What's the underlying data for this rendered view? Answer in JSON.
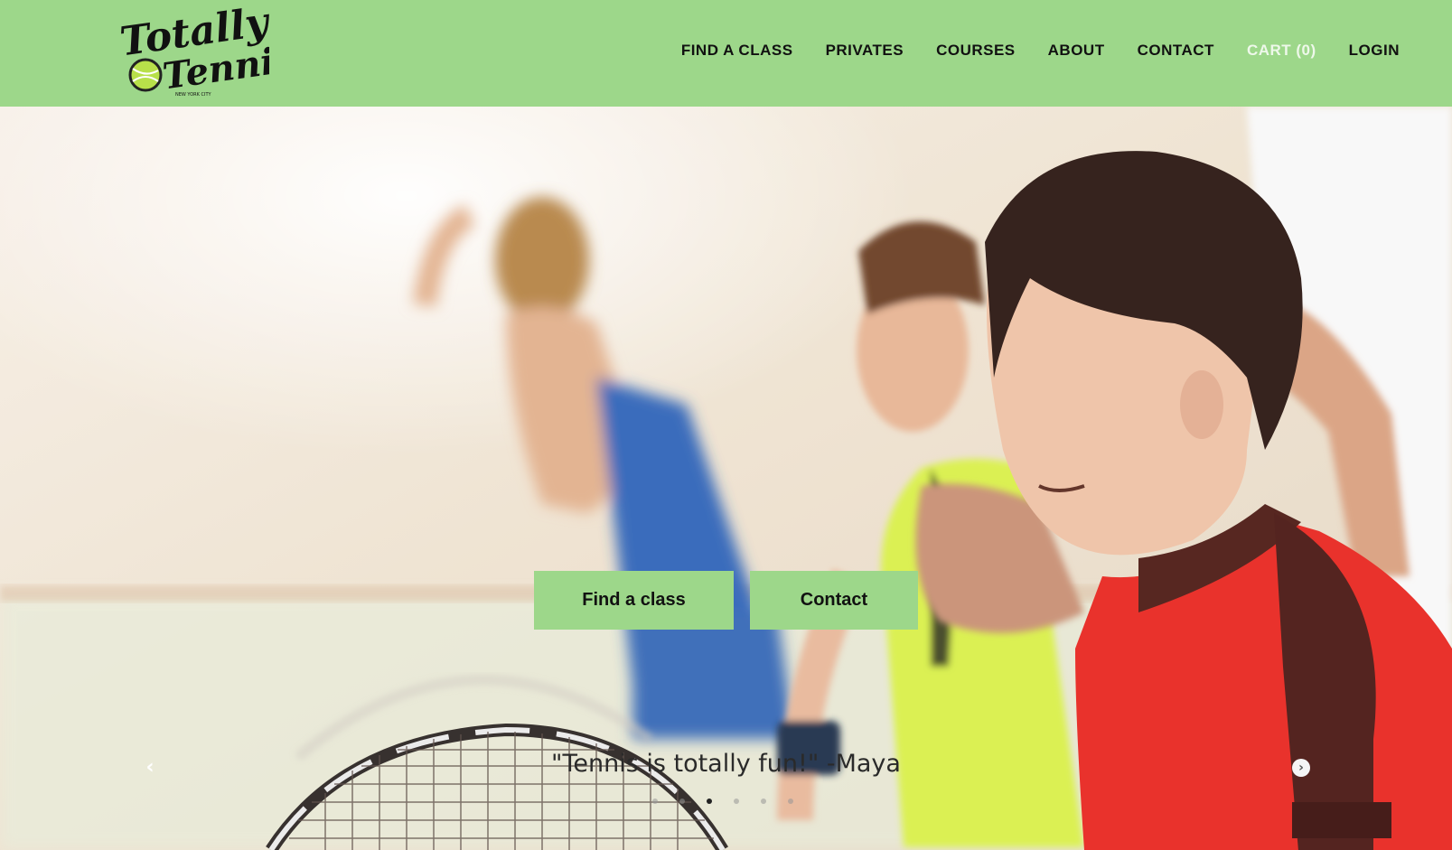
{
  "brand": {
    "logo_line1": "Totally",
    "logo_line2": "Tennis",
    "logo_tagline": "NEW YORK CITY",
    "accent_color": "#9dd78a"
  },
  "nav": {
    "items": [
      {
        "label": "FIND A CLASS"
      },
      {
        "label": "PRIVATES"
      },
      {
        "label": "COURSES"
      },
      {
        "label": "ABOUT"
      },
      {
        "label": "CONTACT"
      },
      {
        "label": "CART (0)"
      },
      {
        "label": "LOGIN"
      }
    ]
  },
  "hero": {
    "buttons": {
      "find_class": "Find a class",
      "contact": "Contact"
    },
    "quote": "\"Tennis is totally fun!\" -Maya",
    "slides": {
      "count": 6,
      "active": 3
    },
    "icons": {
      "prev": "chevron-left-icon",
      "next": "chevron-right-icon"
    }
  }
}
